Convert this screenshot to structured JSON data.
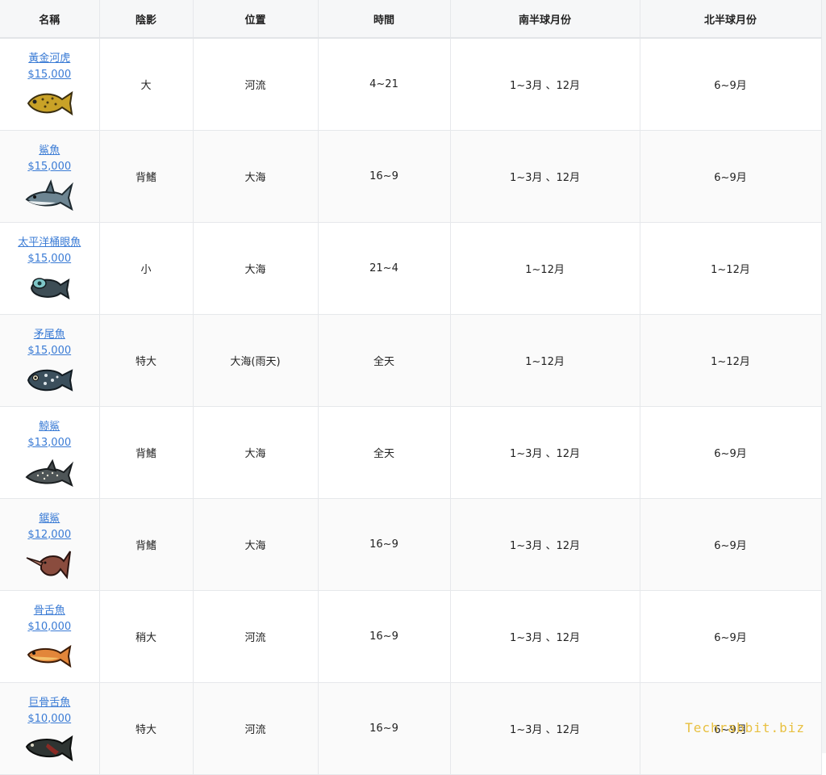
{
  "table": {
    "headers": [
      "名稱",
      "陰影",
      "位置",
      "時間",
      "南半球月份",
      "北半球月份"
    ],
    "rows": [
      {
        "name": "黃金河虎",
        "price": "$15,000",
        "shadow": "大",
        "location": "河流",
        "time": "4~21",
        "south": "1~3月 、12月",
        "north": "6~9月",
        "icon": "golden-trout-icon"
      },
      {
        "name": "鯊魚",
        "price": "$15,000",
        "shadow": "背鰭",
        "location": "大海",
        "time": "16~9",
        "south": "1~3月 、12月",
        "north": "6~9月",
        "icon": "shark-icon"
      },
      {
        "name": "太平洋桶眼魚",
        "price": "$15,000",
        "shadow": "小",
        "location": "大海",
        "time": "21~4",
        "south": "1~12月",
        "north": "1~12月",
        "icon": "barreleye-icon"
      },
      {
        "name": "矛尾魚",
        "price": "$15,000",
        "shadow": "特大",
        "location": "大海(雨天)",
        "time": "全天",
        "south": "1~12月",
        "north": "1~12月",
        "icon": "coelacanth-icon"
      },
      {
        "name": "鯨鯊",
        "price": "$13,000",
        "shadow": "背鰭",
        "location": "大海",
        "time": "全天",
        "south": "1~3月 、12月",
        "north": "6~9月",
        "icon": "whale-shark-icon"
      },
      {
        "name": "鋸鯊",
        "price": "$12,000",
        "shadow": "背鰭",
        "location": "大海",
        "time": "16~9",
        "south": "1~3月 、12月",
        "north": "6~9月",
        "icon": "saw-shark-icon"
      },
      {
        "name": "骨舌魚",
        "price": "$10,000",
        "shadow": "稍大",
        "location": "河流",
        "time": "16~9",
        "south": "1~3月 、12月",
        "north": "6~9月",
        "icon": "arowana-icon"
      },
      {
        "name": "巨骨舌魚",
        "price": "$10,000",
        "shadow": "特大",
        "location": "河流",
        "time": "16~9",
        "south": "1~3月 、12月",
        "north": "6~9月",
        "icon": "arapaima-icon"
      }
    ]
  },
  "watermark": "Techrabbit.biz"
}
